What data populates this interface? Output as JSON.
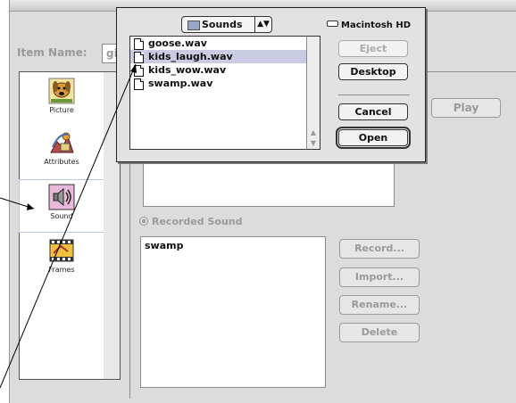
{
  "background_window": {
    "item_name_label": "Item Name:",
    "item_name_value": "gi",
    "categories": [
      {
        "label": "Picture",
        "icon": "dog-picture-icon"
      },
      {
        "label": "Attributes",
        "icon": "attributes-icon"
      },
      {
        "label": "Sound",
        "icon": "speaker-icon"
      },
      {
        "label": "Frames",
        "icon": "film-frames-icon"
      }
    ],
    "play_label": "Play",
    "recorded_sound_label": "Recorded Sound",
    "recorded_sounds": [
      "swamp"
    ],
    "side_buttons": [
      "Record...",
      "Import...",
      "Rename...",
      "Delete"
    ]
  },
  "open_dialog": {
    "folder_popup": "Sounds",
    "disk_name": "Macintosh HD",
    "files": [
      {
        "name": "goose.wav",
        "selected": false
      },
      {
        "name": "kids_laugh.wav",
        "selected": true
      },
      {
        "name": "kids_wow.wav",
        "selected": false
      },
      {
        "name": "swamp.wav",
        "selected": false
      }
    ],
    "buttons": {
      "eject": "Eject",
      "desktop": "Desktop",
      "cancel": "Cancel",
      "open": "Open"
    }
  },
  "colors": {
    "selection": "#c9cbe3",
    "disabled_text": "#9a9a9a"
  }
}
